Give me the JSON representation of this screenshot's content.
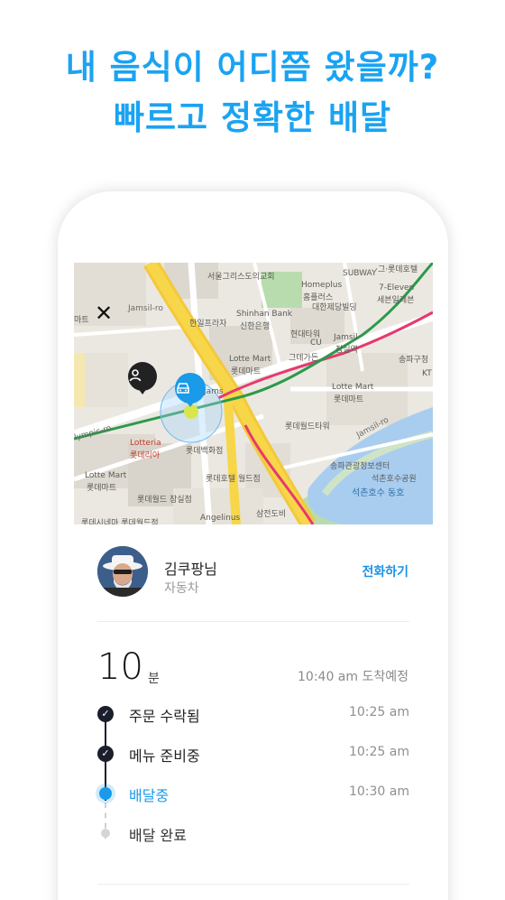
{
  "headline": {
    "line1": "내 음식이 어디쯤 왔을까?",
    "line2": "빠르고 정확한 배달"
  },
  "map": {
    "labels": {
      "seoul_cross": "서울그리스도의교회",
      "homeplus": "Homeplus",
      "homeplus_ko": "홈플러스",
      "subway": "SUBWAY",
      "lotte_ho": "·그·롯데호텔",
      "daehan": "대한제당빌딩",
      "seven": "7-Eleven",
      "seven_ko": "세븐일레븐",
      "jamsil_ro_top": "Jamsil-ro",
      "hanil": "한일프라자",
      "shinhan": "Shinhan Bank",
      "shinhan_ko": "신한은행",
      "hyundai": "현대타워",
      "cu": "CU",
      "jamsil": "Jamsil",
      "jamsil_ko": "잠실역",
      "songpa": "송파구청",
      "lotte_mart1": "Lotte Mart",
      "lotte_mart1_ko": "롯데마트",
      "lotte_gadget": "그데가든",
      "kt": "KT",
      "lotte_mart2": "Lotte Mart",
      "lotte_mart2_ko": "롯데마트",
      "jams_frag": "Jams",
      "olympic": "lympic-ro",
      "lotte_world_tower": "롯데월드타워",
      "jamsil_ro_right": "Jamsil-ro",
      "lotteria": "Lotteria",
      "lotteria_ko": "롯데리아",
      "lotte_dept": "롯데백화점",
      "songpa_mgmt": "송파관광정보센터",
      "seokchon_park": "석촌호수공원",
      "lotte_mart3": "Lotte Mart",
      "lotte_mart3_ko": "롯데마트",
      "lotte_hotel_world": "롯데호텔 월드점",
      "lake": "석촌호수 동호",
      "lotte_world_store": "롯데월드 잠실점",
      "angelinus": "Angelinus",
      "samjeon": "삼전도비",
      "cinema": "롯데시네마 롯데월드점",
      "mart_frag": "마트"
    },
    "close_icon": "close-icon",
    "user_pin_icon": "user-pin-icon",
    "driver_pin_icon": "car-icon"
  },
  "courier": {
    "name": "김쿠팡님",
    "vehicle": "자동차",
    "call_label": "전화하기"
  },
  "eta": {
    "minutes": "10",
    "unit": "분",
    "arrival": "10:40 am 도착예정"
  },
  "steps": [
    {
      "label": "주문 수락됨",
      "time": "10:25 am",
      "state": "done"
    },
    {
      "label": "메뉴 준비중",
      "time": "10:25 am",
      "state": "done"
    },
    {
      "label": "배달중",
      "time": "10:30 am",
      "state": "active"
    },
    {
      "label": "배달 완료",
      "time": "",
      "state": "pending"
    }
  ],
  "colors": {
    "accent": "#1aa3f2",
    "dark": "#1b1e2b",
    "road_yellow": "#f7d64a",
    "line_pink": "#e8386e",
    "line_green": "#2b9a4a",
    "lake": "#a9cdef"
  }
}
